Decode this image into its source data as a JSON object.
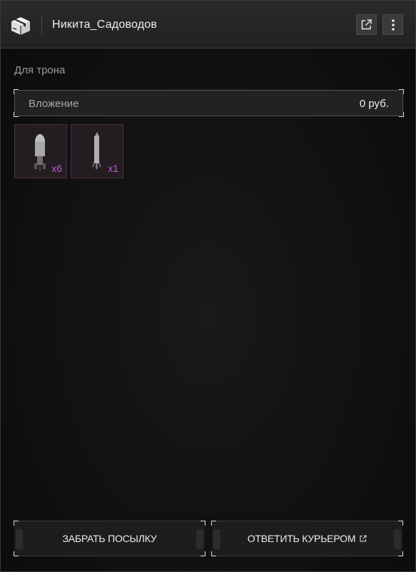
{
  "header": {
    "icon": "box-icon",
    "title": "Никита_Садоводов",
    "open_external_icon": "external-link-icon",
    "more_icon": "more-vertical-icon"
  },
  "parcel": {
    "subject": "Для трона",
    "attachment_label": "Вложение",
    "attachment_amount": "0 руб.",
    "items": [
      {
        "icon": "bomb-icon",
        "count": "x6"
      },
      {
        "icon": "rocket-icon",
        "count": "x1"
      }
    ]
  },
  "actions": {
    "take_label": "ЗАБРАТЬ ПОСЫЛКУ",
    "reply_label": "ОТВЕТИТЬ КУРЬЕРОМ"
  },
  "colors": {
    "item_count": "#c25bd0",
    "item_border": "#4a3244",
    "background": "#0c0c0c"
  }
}
